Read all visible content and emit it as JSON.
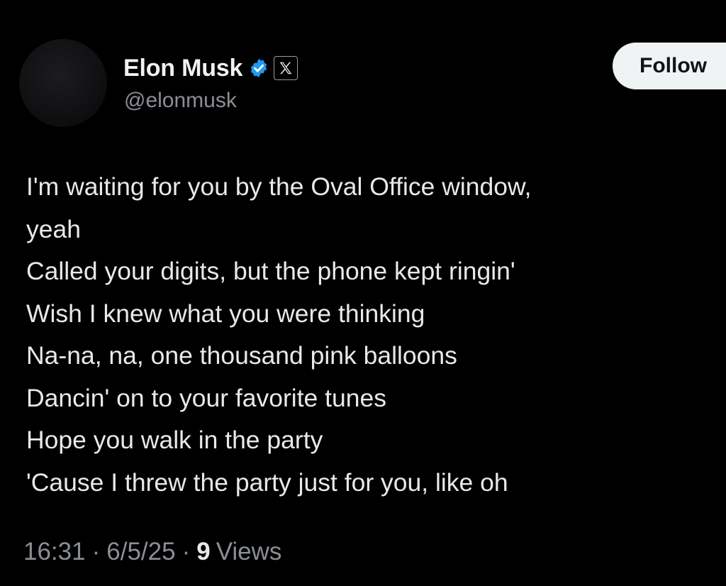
{
  "author": {
    "display_name": "Elon Musk",
    "handle": "@elonmusk",
    "verified_icon": "verified-badge-icon",
    "affiliate_icon": "x-logo-icon"
  },
  "actions": {
    "follow_label": "Follow"
  },
  "tweet": {
    "lines": [
      "I'm waiting for you by the Oval Office window,",
      "yeah",
      "Called your digits, but the phone kept ringin'",
      "Wish I knew what you were thinking",
      "Na-na, na, one thousand pink balloons",
      "Dancin' on to your favorite tunes",
      "Hope you walk in the party",
      "'Cause I threw the party just for you, like oh"
    ]
  },
  "meta": {
    "time": "16:31",
    "separator": "·",
    "date": "6/5/25",
    "views_count": "9",
    "views_label": "Views"
  },
  "colors": {
    "background": "#000000",
    "text": "#e7e9ea",
    "secondary_text": "#8b8f94",
    "verified_blue": "#1d9bf0",
    "follow_button_bg": "#eff3f4"
  }
}
